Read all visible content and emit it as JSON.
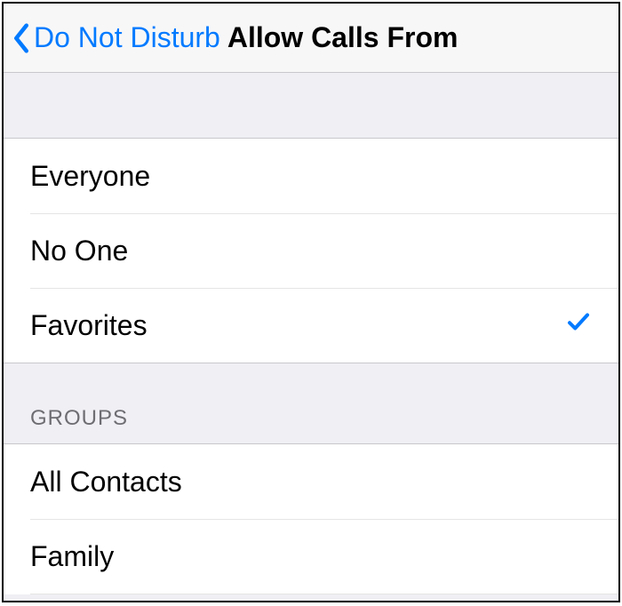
{
  "nav": {
    "back_label": "Do Not Disturb",
    "title": "Allow Calls From"
  },
  "options": [
    {
      "label": "Everyone",
      "selected": false
    },
    {
      "label": "No One",
      "selected": false
    },
    {
      "label": "Favorites",
      "selected": true
    }
  ],
  "groups_header": "GROUPS",
  "groups": [
    {
      "label": "All Contacts"
    },
    {
      "label": "Family"
    }
  ],
  "colors": {
    "tint": "#007aff",
    "section_bg": "#efeff4",
    "separator": "#c8c7cc"
  }
}
